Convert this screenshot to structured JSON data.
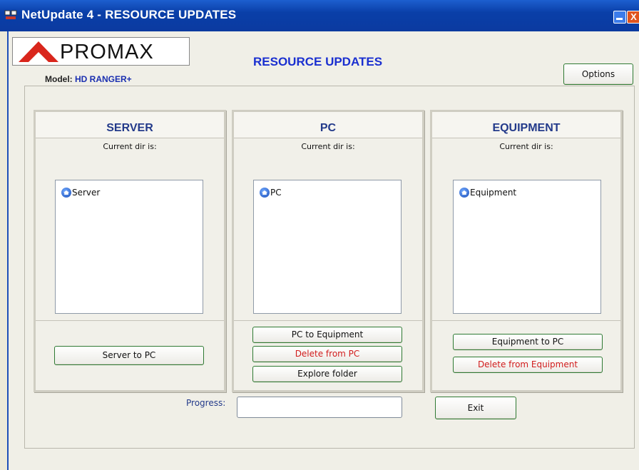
{
  "window": {
    "title": "NetUpdate 4 - RESOURCE UPDATES",
    "close_glyph": "X"
  },
  "logo": {
    "text": "PROMAX",
    "triangle_color": "#d9261c"
  },
  "model": {
    "label": "Model:",
    "value": "HD RANGER+"
  },
  "header": {
    "title": "RESOURCE UPDATES"
  },
  "options_label": "Options",
  "panels": [
    {
      "title": "SERVER",
      "current_dir": "Current dir is:",
      "item": "Server"
    },
    {
      "title": "PC",
      "current_dir": "Current dir is:",
      "item": "PC"
    },
    {
      "title": "EQUIPMENT",
      "current_dir": "Current dir is:",
      "item": "Equipment"
    }
  ],
  "buttons": {
    "server_to_pc": "Server to PC",
    "pc_to_equipment": "PC to Equipment",
    "delete_from_pc": "Delete from PC",
    "explore_folder": "Explore folder",
    "equipment_to_pc": "Equipment to PC",
    "delete_from_equipment": "Delete from Equipment"
  },
  "progress_label": "Progress:",
  "exit_label": "Exit",
  "colors": {
    "titlebar": "#0b3aa0",
    "accent_title": "#1a2fd0",
    "danger": "#d11c1c",
    "button_border": "#2f7a33"
  }
}
